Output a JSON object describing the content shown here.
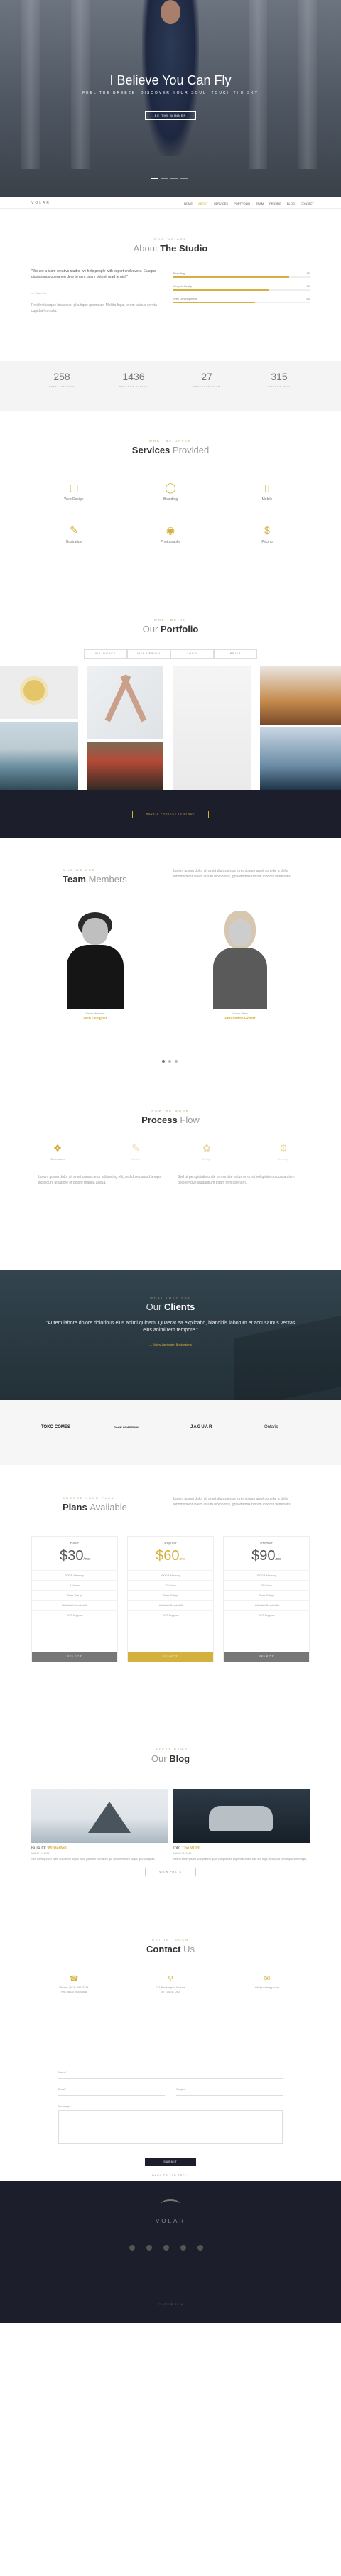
{
  "hero": {
    "title": "I Believe You Can Fly",
    "subtitle": "FEEL THE BREEZE, DISCOVER YOUR SOUL, TOUCH THE SKY",
    "button": "BE THE WINNER"
  },
  "nav": {
    "logo": "VOLAR",
    "items": [
      "HOME",
      "ABOUT",
      "SERVICES",
      "PORTFOLIO",
      "TEAM",
      "PRICING",
      "BLOG",
      "CONTACT"
    ]
  },
  "about": {
    "kicker": "WHO WE ARE",
    "title_light": "About",
    "title_bold": "The Studio",
    "quote": "\"We are a team creative studio. we help people with expert endeavors. Eiusque dignissimos operahen dere to mim quam obtenit grad te nisl.\"",
    "sign": "— Volar Inc.",
    "desc": "Proident iaaque labasque, ploutique quumque. Mollita fuga, lorem latinus sereta cupidat ho nulla.",
    "skills": [
      {
        "label": "Branding",
        "value": 85
      },
      {
        "label": "Graphic Design",
        "value": 70
      },
      {
        "label": "Web Development",
        "value": 60
      }
    ]
  },
  "counters": [
    {
      "n": "258",
      "l": "HAPPY CLIENTS"
    },
    {
      "n": "1436",
      "l": "DOLLARS RAISED"
    },
    {
      "n": "27",
      "l": "PROJECTS DONE"
    },
    {
      "n": "315",
      "l": "AWARDS WON"
    }
  ],
  "services": {
    "kicker": "WHAT WE OFFER",
    "title_bold": "Services",
    "title_light": "Provided",
    "items": [
      "Web Design",
      "Branding",
      "Mobile",
      "Illustration",
      "Photography",
      "Pricing"
    ]
  },
  "portfolio": {
    "kicker": "WHAT WE DO",
    "title_light": "Our",
    "title_bold": "Portfolio",
    "filters": [
      "ALL WORKS",
      "WEB DESIGN",
      "LOGO",
      "PRINT"
    ],
    "cta": "HAVE A PROJECT IN MIND?"
  },
  "team": {
    "kicker": "WHO WE ARE",
    "title_bold": "Team",
    "title_light": "Members",
    "intro": "Lorem ipsum dolor sit amet dignissimos loremipsum amet sonebe a dolor lobortisdolor lorem ipsum leolobortis, gravidamas rutrum lobortis venenatis.",
    "members": [
      {
        "name": "Derek Hummel",
        "role": "Web Designer"
      },
      {
        "name": "Grace Starn",
        "role": "Photoshop Expert"
      }
    ]
  },
  "process": {
    "kicker": "HOW WE WORK",
    "title_bold": "Process",
    "title_light": "Flow",
    "steps": [
      "Brainstorm",
      "Sketch",
      "Design",
      "Develop"
    ],
    "text_left": "Lorem ipsum dolor sit amet consectetur adipiscing elit, sed do eiusmod tempor incididunt ut labore et dolore magna aliqua.",
    "text_right": "Sed ut perspiciatis unde omnis iste natus error sit voluptatem accusantium doloremque laudantium totam rem aperiam."
  },
  "clients": {
    "kicker": "WHAT THEY SAY",
    "title_light": "Our",
    "title_bold": "Clients",
    "quote": "\"Autem labore dolore doloribus eius animi quidem. Quaerat ea explicabo, blanditiis laborum et accusamus veritas eius animi rem tempore.\"",
    "author": "— Bobby Lambgate, Bookmakers",
    "logos": [
      "TOKO COMES",
      "RAGE GRASSMAN",
      "JAGUAR",
      "Ontario"
    ]
  },
  "pricing": {
    "kicker": "CHOOSE YOUR PLAN",
    "title_bold": "Plans",
    "title_light": "Available",
    "intro": "Lorem ipsum dolor sit amet dignissimos loremipsum amet sonebe a dolor lobortisdolor lorem ipsum leolobortis, gravidamas rutrum lobortis venenatis.",
    "plans": [
      {
        "name": "Basic",
        "price": "$30",
        "per": "/mo",
        "features": [
          "50GB Memory",
          "5 Users",
          "Free Setup",
          "Unlimited Bandwidth",
          "24/7 Support"
        ],
        "button": "SELECT"
      },
      {
        "name": "Popular",
        "price": "$60",
        "per": "/mo",
        "features": [
          "100GB Memory",
          "10 Users",
          "Free Setup",
          "Unlimited Bandwidth",
          "24/7 Support"
        ],
        "button": "SELECT"
      },
      {
        "name": "Premier",
        "price": "$90",
        "per": "/mo",
        "features": [
          "150GB Memory",
          "15 Users",
          "Free Setup",
          "Unlimited Bandwidth",
          "24/7 Support"
        ],
        "button": "SELECT"
      }
    ]
  },
  "blog": {
    "kicker": "LATEST NEWS",
    "title_light": "Our",
    "title_bold": "Blog",
    "posts": [
      {
        "t1": "Bura Of",
        "t2": "Winterfell",
        "date": "MARCH 4, 2016",
        "ex": "Sed nam qui vel illum dolore eu fugiat nulla pariatur. Vel illum qui dolorem eum fugiat quo voluptas."
      },
      {
        "t1": "Into",
        "t2": "The Wild",
        "date": "MARCH 1, 2016",
        "ex": "Nemo enim ipsam voluptatem quia voluptas sit aspernatur aut odit aut fugit, sed quia consequuntur magni."
      }
    ],
    "button": "VIEW POSTS"
  },
  "contact": {
    "kicker": "GET IN TOUCH",
    "title": "Contact",
    "title_light": "Us",
    "info": [
      {
        "icon": "phone-icon",
        "t": "Phone: (812) 555-3214\nFax: (818) 365-6868"
      },
      {
        "icon": "pin-icon",
        "t": "121 Kensington Avenue\nNY 10001, USA"
      },
      {
        "icon": "mail-icon",
        "t": "info@volarapp.com"
      }
    ],
    "fields": {
      "name": "Name*",
      "email": "Email*",
      "subject": "Subject",
      "message": "Message*"
    },
    "send": "SUBMIT"
  },
  "totop": "BACK TO THE TOP ˄",
  "footer": {
    "logo": "VOLAR",
    "copy": "© VOLAR 2016"
  }
}
